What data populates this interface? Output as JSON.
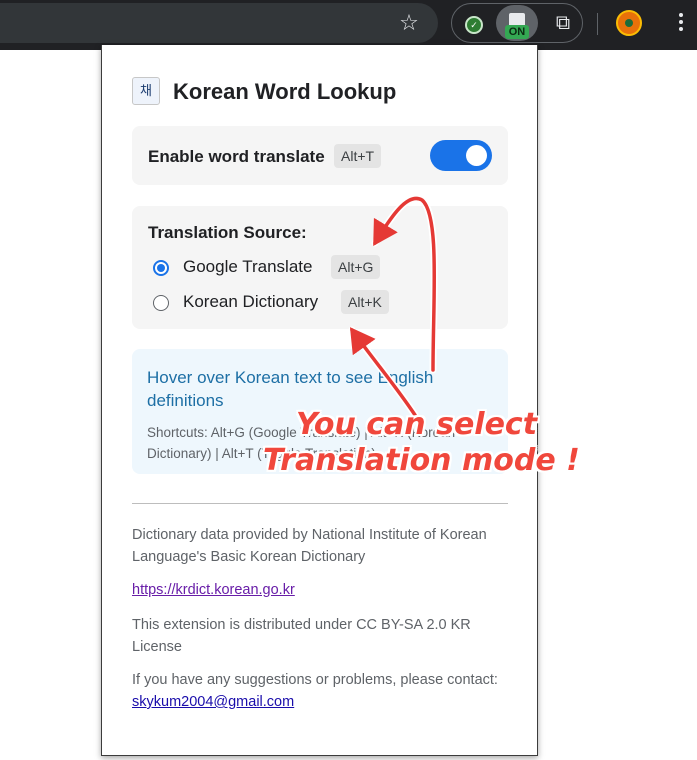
{
  "toolbar": {
    "star_icon": "bookmark-star-icon",
    "extension_badge": "ON",
    "accent": "#34a853"
  },
  "popup": {
    "logo_text": "채",
    "title": "Korean Word Lookup",
    "enable": {
      "label": "Enable word translate",
      "shortcut": "Alt+T",
      "toggle_on": true,
      "toggle_color": "#1a73e8"
    },
    "source": {
      "title": "Translation Source:",
      "options": [
        {
          "label": "Google Translate",
          "shortcut": "Alt+G",
          "selected": true
        },
        {
          "label": "Korean Dictionary",
          "shortcut": "Alt+K",
          "selected": false
        }
      ]
    },
    "info": {
      "text": "Hover over Korean text to see English definitions",
      "shortcuts": "Shortcuts: Alt+G (Google Translate) | Alt+K (Korean Dictionary) | Alt+T (Toggle Translation)"
    },
    "footer": {
      "attribution": "Dictionary data provided by National Institute of Korean Language's Basic Korean Dictionary",
      "link": "https://krdict.korean.go.kr",
      "license": "This extension is distributed under CC BY-SA 2.0 KR License",
      "contact_prompt": "If you have any suggestions or problems, please contact:",
      "contact_email": "skykum2004@gmail.com"
    }
  },
  "annotation": {
    "line1": "You can select",
    "line2": "Translation mode !",
    "color": "#f0473c"
  }
}
